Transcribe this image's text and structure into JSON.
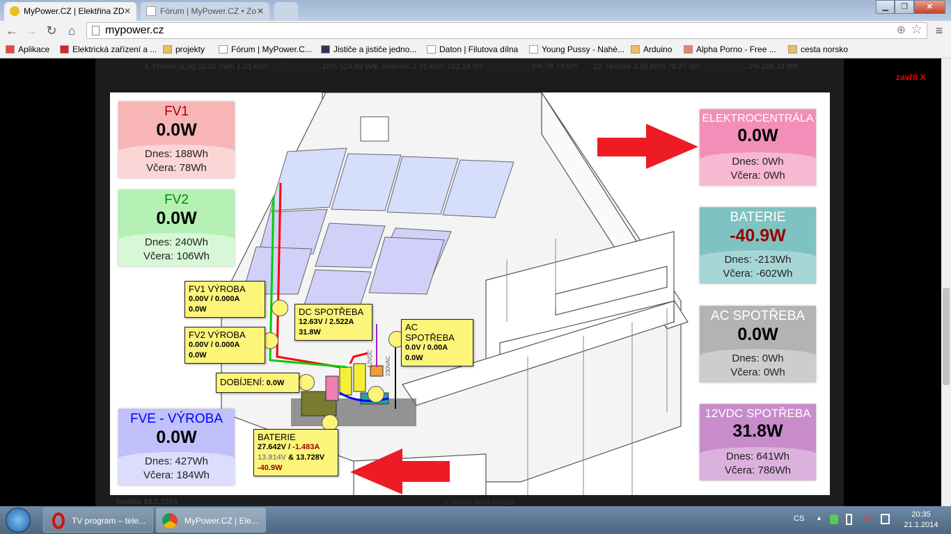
{
  "browser": {
    "tabs": [
      {
        "title": "MyPower.CZ | Elektřina ZD",
        "active": true
      },
      {
        "title": "Fórum | MyPower.CZ • Zo",
        "active": false
      }
    ],
    "url": "mypower.cz",
    "bookmarks": [
      "Aplikace",
      "Elektrická zařízení a ...",
      "projekty",
      "Fórum | MyPower.C...",
      "Jističe a jističe jedno...",
      "Daton | Filutova dílna",
      "Young Pussy - Nahé...",
      "Arduino",
      "Alpha Porno - Free ...",
      "cesta norsko"
    ]
  },
  "background_page": {
    "stats": [
      "4. Prešov uLog 10.01 kWh 1.03 kWh ░░░░░░░░░ 10% 524.69 Wh",
      "8. Kokonín 2.55 kWh 192.14 Wh ░░░░░░░░ 8% 78.73 Wh",
      "12. Hrnčíře 3.59 kWh 78.37 Wh ░░░░░░░░ 2% 168.34 Wh"
    ],
    "date": "Neděle 19.1.2014",
    "week": "3. týden | Nová témata"
  },
  "close_link": "zavřít X",
  "panels": {
    "fv1": {
      "title": "FV1",
      "value": "0.0W",
      "today": "Dnes: 188Wh",
      "yesterday": "Včera: 78Wh"
    },
    "fv2": {
      "title": "FV2",
      "value": "0.0W",
      "today": "Dnes: 240Wh",
      "yesterday": "Včera: 106Wh"
    },
    "fve": {
      "title": "FVE - VÝROBA",
      "value": "0.0W",
      "today": "Dnes: 427Wh",
      "yesterday": "Včera: 184Wh"
    },
    "gen": {
      "title": "ELEKTROCENTRÁLA",
      "value": "0.0W",
      "today": "Dnes: 0Wh",
      "yesterday": "Včera: 0Wh"
    },
    "bat": {
      "title": "BATERIE",
      "value": "-40.9W",
      "today": "Dnes: -213Wh",
      "yesterday": "Včera: -602Wh"
    },
    "ac": {
      "title": "AC SPOTŘEBA",
      "value": "0.0W",
      "today": "Dnes: 0Wh",
      "yesterday": "Včera: 0Wh"
    },
    "dc12": {
      "title": "12VDC SPOTŘEBA",
      "value": "31.8W",
      "today": "Dnes: 641Wh",
      "yesterday": "Včera: 786Wh"
    }
  },
  "labels": {
    "fv1": {
      "title": "FV1 VÝROBA",
      "line1": "0.00V / 0.000A",
      "line2": "0.0W"
    },
    "fv2": {
      "title": "FV2 VÝROBA",
      "line1": "0.00V / 0.000A",
      "line2": "0.0W"
    },
    "dc": {
      "title": "DC SPOTŘEBA",
      "line1": "12.63V / 2.522A",
      "line2": "31.8W"
    },
    "ac": {
      "title": "AC SPOTŘEBA",
      "line1": "0.0V / 0.00A",
      "line2": "0.0W"
    },
    "charge": {
      "title": "DOBÍJENÍ:",
      "value": "0.0W"
    },
    "bat": {
      "title": "BATERIE",
      "voltage": "27.642V /",
      "current": "-1.483A",
      "cell1": "13.914V",
      "amp": "&",
      "cell2": "13.728V",
      "power": "-40.9W"
    },
    "wire12": "12VDC",
    "wire230": "230VAC"
  },
  "taskbar": {
    "items": [
      "TV program – tele...",
      "MyPower.CZ | Ele..."
    ],
    "lang": "CS",
    "time": "20:35",
    "date": "21.1.2014"
  },
  "colors": {
    "fv1": "#f7b5b5",
    "fv2": "#b5f0b5",
    "fve": "#c0c0fa",
    "gen": "#f28fb8",
    "bat": "#7fc2c2",
    "ac": "#b3b3b3",
    "dc12": "#c88ccb",
    "arrow": "#ed1c24"
  }
}
